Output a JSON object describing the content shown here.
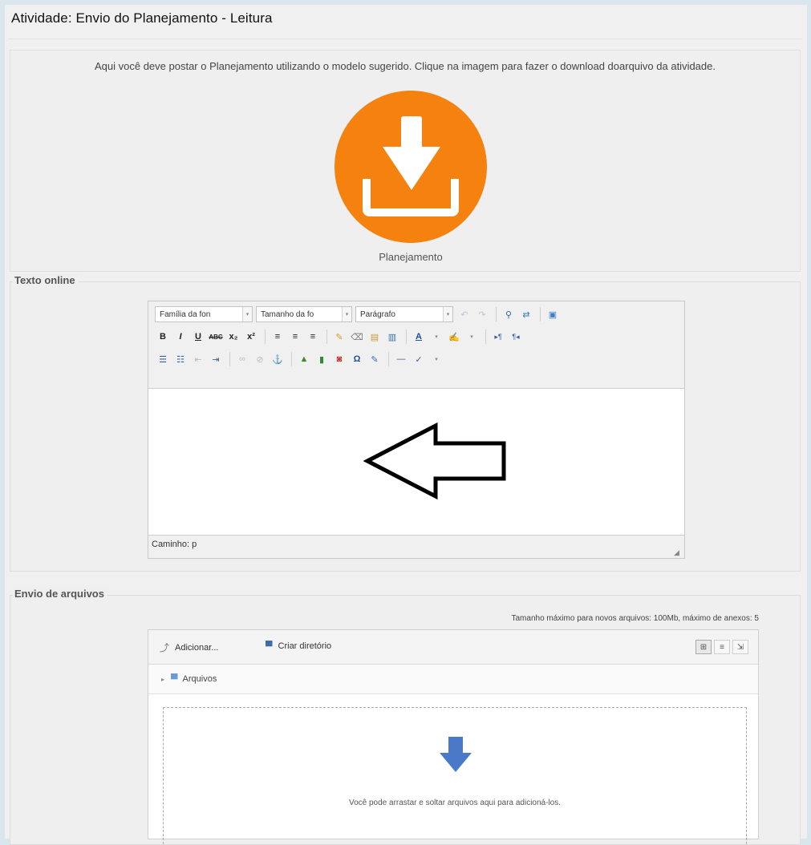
{
  "page": {
    "title": "Atividade: Envio do Planejamento - Leitura"
  },
  "intro": {
    "text": "Aqui você deve postar o Planejamento utilizando o modelo sugerido. Clique na imagem para fazer o download doarquivo da atividade.",
    "download_caption": "Planejamento",
    "icon": "download-icon",
    "icon_color": "#f5820e"
  },
  "online_text": {
    "legend": "Texto online",
    "font_family_placeholder": "Família da fon",
    "font_size_placeholder": "Tamanho da fo",
    "paragraph_format": "Parágrafo",
    "toolbar_row2": [
      "B",
      "I",
      "U",
      "ABC",
      "x₂",
      "x²"
    ],
    "path_label": "Caminho: p"
  },
  "files": {
    "legend": "Envio de arquivos",
    "limits": "Tamanho máximo para novos arquivos: 100Mb, máximo de anexos: 5",
    "add_label": "Adicionar...",
    "create_dir_label": "Criar diretório",
    "folder_label": "Arquivos",
    "drop_text": "Você pode arrastar e soltar arquivos aqui para adicioná-los.",
    "drop_icon_color": "#4a79c9"
  }
}
